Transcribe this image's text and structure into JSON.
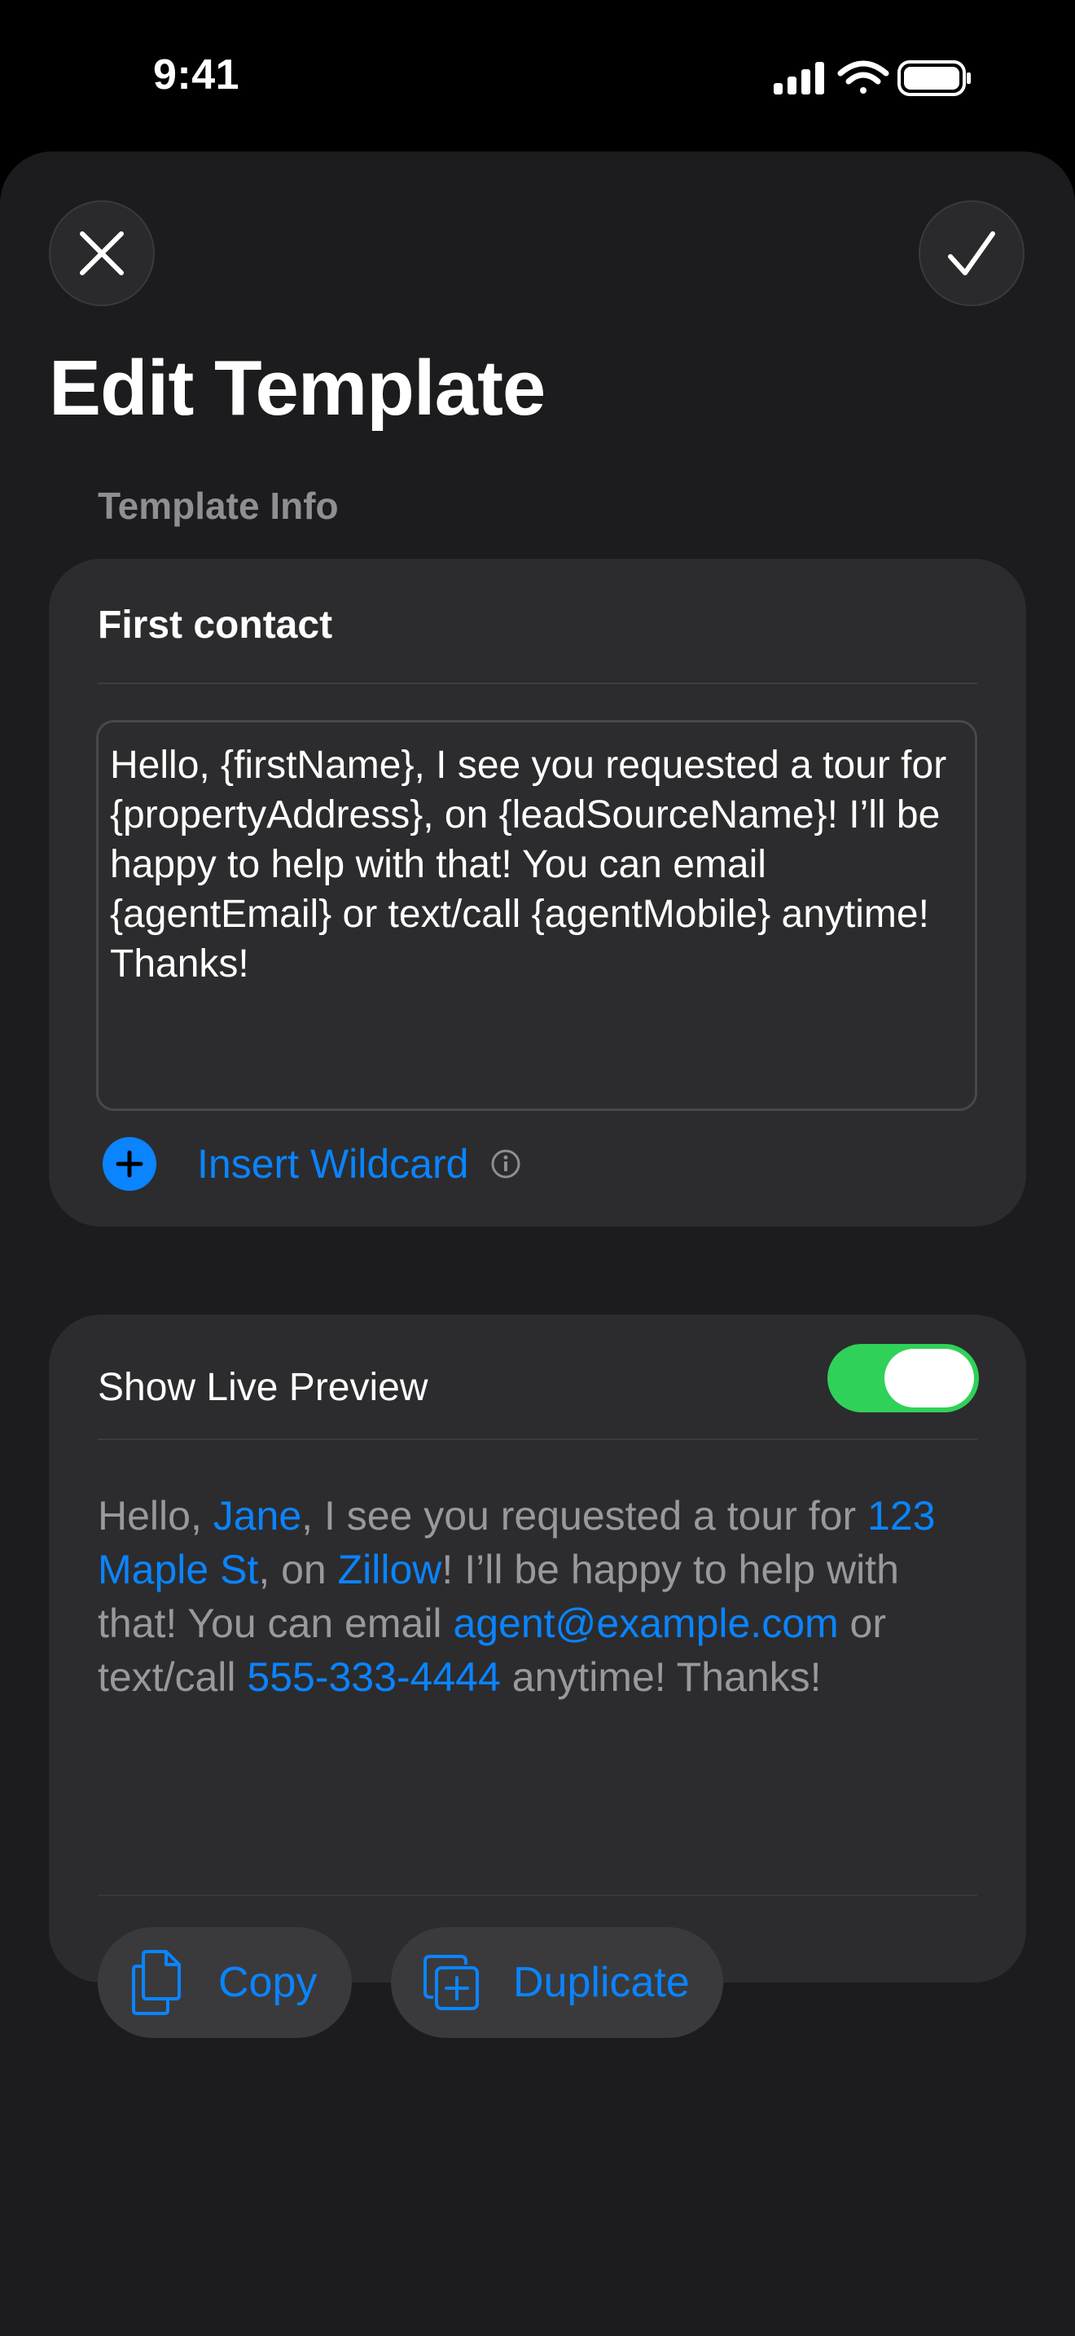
{
  "status_bar": {
    "time": "9:41"
  },
  "nav": {
    "title": "Edit Template",
    "close_icon": "xmark-icon",
    "confirm_icon": "checkmark-icon"
  },
  "template_info": {
    "section_header": "Template Info",
    "name": "First contact",
    "body": "Hello, {firstName}, I see you requested a tour for {propertyAddress}, on {leadSourceName}! I’ll be happy to help with that! You can email {agentEmail} or text/call {agentMobile} anytime! Thanks!",
    "insert_wildcard_label": "Insert Wildcard"
  },
  "preview": {
    "label": "Show Live Preview",
    "toggle_on": true,
    "segments": [
      {
        "text": "Hello, ",
        "wildcard": false
      },
      {
        "text": "Jane",
        "wildcard": true
      },
      {
        "text": ", I see you requested a tour for ",
        "wildcard": false
      },
      {
        "text": "123 Maple St",
        "wildcard": true
      },
      {
        "text": ", on ",
        "wildcard": false
      },
      {
        "text": "Zillow",
        "wildcard": true
      },
      {
        "text": "! I’ll be happy to help with that! You can email ",
        "wildcard": false
      },
      {
        "text": "agent@example.com",
        "wildcard": true
      },
      {
        "text": " or text/call ",
        "wildcard": false
      },
      {
        "text": "555-333-4444",
        "wildcard": true
      },
      {
        "text": " anytime! Thanks!",
        "wildcard": false
      }
    ],
    "copy_label": "Copy",
    "duplicate_label": "Duplicate"
  },
  "colors": {
    "accent": "#0a84ff",
    "toggle_on": "#30d158",
    "card": "#2c2c2e",
    "sheet": "#1c1c1e"
  }
}
